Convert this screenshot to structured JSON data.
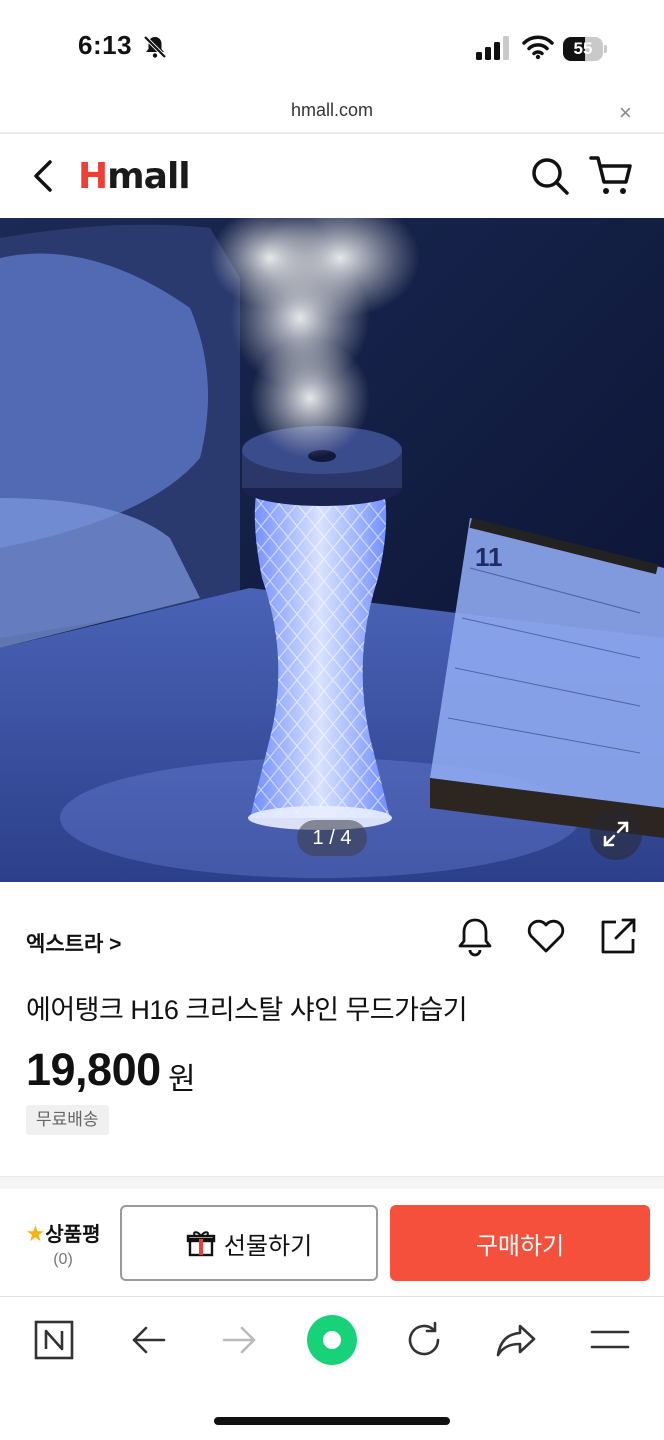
{
  "status_bar": {
    "time": "6:13",
    "battery": "55",
    "battery_level": 0.55
  },
  "url_bar": {
    "domain": "hmall.com",
    "close_symbol": "×"
  },
  "header": {
    "logo_h": "H",
    "logo_rest": "mall",
    "icons": [
      "back-icon",
      "search-icon",
      "cart-icon"
    ]
  },
  "gallery": {
    "pager": "1 / 4",
    "expand_icon": "expand-icon"
  },
  "product": {
    "brand": "엑스트라 >",
    "title": "에어탱크 H16 크리스탈 샤인 무드가습기",
    "price": "19,800",
    "price_unit": "원",
    "shipping_badge": "무료배송",
    "icons": [
      "bell-icon",
      "heart-icon",
      "share-icon"
    ]
  },
  "action_bar": {
    "review_label": "상품평",
    "review_count": "(0)",
    "gift_label": "선물하기",
    "buy_label": "구매하기",
    "colors": {
      "buy": "#f4503b",
      "star": "#f5b316"
    }
  },
  "browser_toolbar": {
    "items": [
      "naver-n-icon",
      "back-arrow-icon",
      "forward-arrow-icon",
      "home-dot-icon",
      "reload-icon",
      "share-arrow-icon",
      "menu-icon"
    ],
    "accent": "#18d27a"
  },
  "colors": {
    "brand_red": "#ef3e36"
  }
}
